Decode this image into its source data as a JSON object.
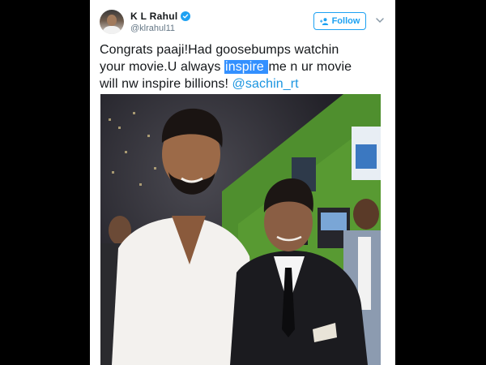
{
  "tweet": {
    "author_name": "K L Rahul",
    "author_handle": "@klrahul11",
    "follow_label": "Follow",
    "text": {
      "line1": "Congrats paaji!Had goosebumps watchin",
      "line2_before": "your movie.U always ",
      "line2_highlight": "inspire ",
      "line2_after": "me n ur movie",
      "line3_before": "will nw inspire billions! ",
      "mention": "@sachin_rt"
    }
  },
  "icons": {
    "verified": "verified-badge-icon",
    "follow": "add-user-icon",
    "caret": "chevron-down-icon"
  },
  "colors": {
    "accent": "#1da1f2",
    "mention": "#1b95e0",
    "selection": "#3390ff",
    "text": "#14171a",
    "muted": "#657786"
  }
}
